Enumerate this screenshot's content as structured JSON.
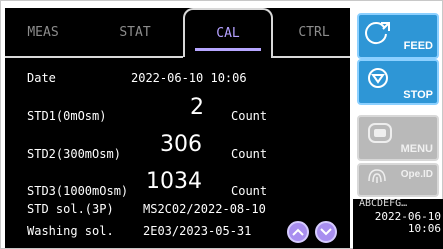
{
  "tabs": [
    {
      "label": "MEAS"
    },
    {
      "label": "STAT"
    },
    {
      "label": "CAL"
    },
    {
      "label": "CTRL"
    }
  ],
  "active_tab": "CAL",
  "rows": {
    "date": {
      "label": "Date",
      "value": "2022-06-10 10:06"
    },
    "std1": {
      "label": "STD1(0mOsm)",
      "value": "2",
      "unit": "Count"
    },
    "std2": {
      "label": "STD2(300mOsm)",
      "value": "306",
      "unit": "Count"
    },
    "std3": {
      "label": "STD3(1000mOsm)",
      "value": "1034",
      "unit": "Count"
    },
    "std_sol": {
      "label": "STD sol.(3P)",
      "value": "MS2C02/2022-08-10"
    },
    "washing": {
      "label": "Washing sol.",
      "value": "2E03/2023-05-31"
    }
  },
  "side_buttons": {
    "feed": "FEED",
    "stop": "STOP",
    "menu": "MENU",
    "opeid_top": "Ope.ID",
    "opeid_bottom": "ABCDEFG…"
  },
  "clock": {
    "date": "2022-06-10",
    "time": "10:06"
  },
  "colors": {
    "accent": "#a88ef0",
    "button_blue": "#2e96d6",
    "button_gray": "#b9b9b9"
  }
}
